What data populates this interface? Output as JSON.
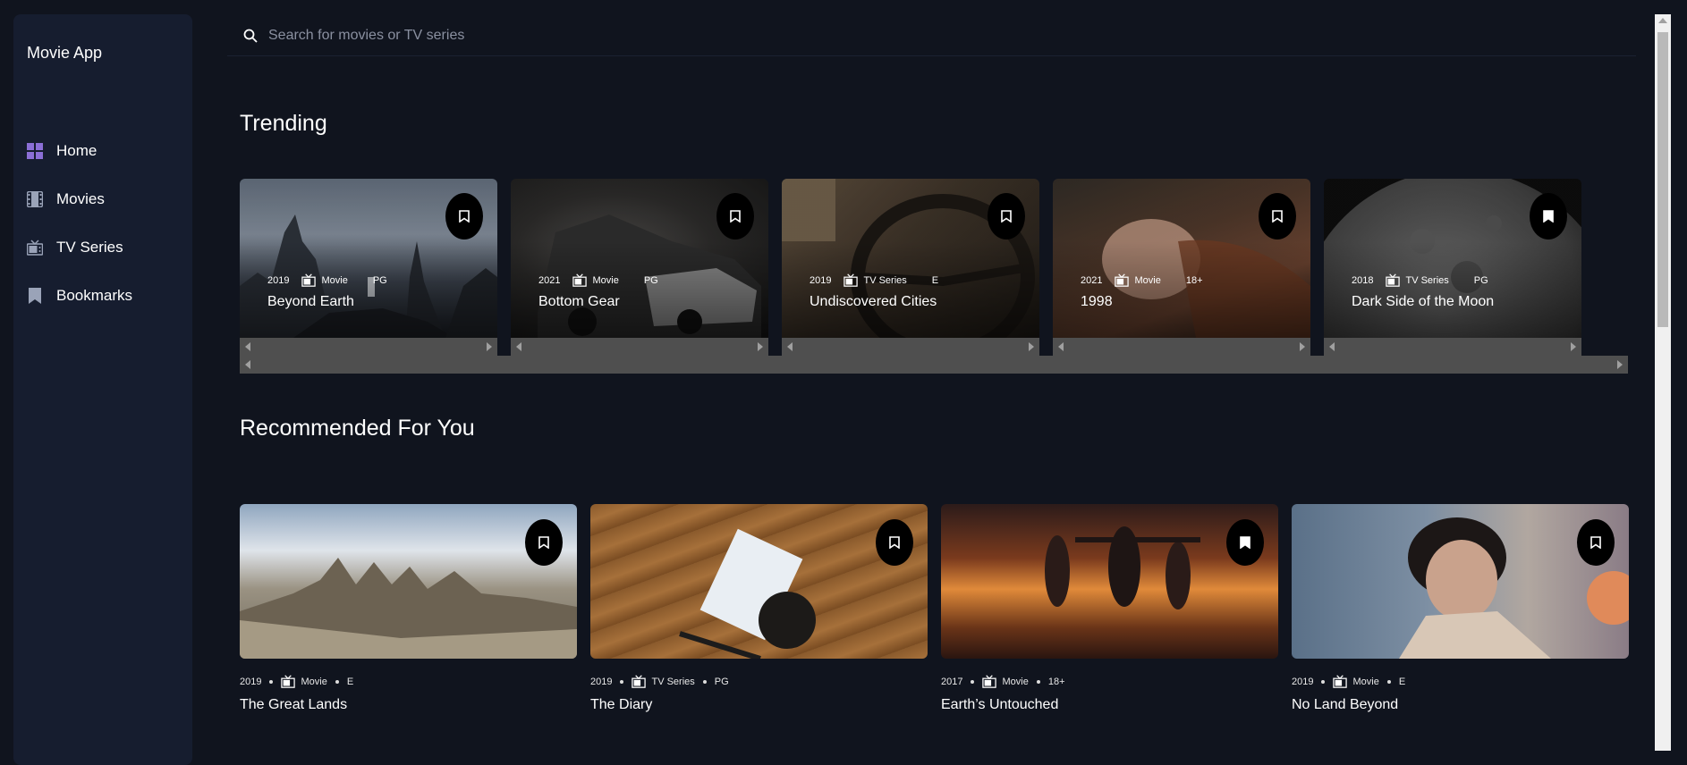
{
  "app": {
    "title": "Movie App"
  },
  "sidebar": {
    "items": [
      {
        "label": "Home",
        "icon": "grid-icon",
        "active": true
      },
      {
        "label": "Movies",
        "icon": "film-icon"
      },
      {
        "label": "TV Series",
        "icon": "tv-icon"
      },
      {
        "label": "Bookmarks",
        "icon": "bookmark-icon"
      }
    ]
  },
  "search": {
    "placeholder": "Search for movies or TV series"
  },
  "trending": {
    "title": "Trending",
    "items": [
      {
        "year": "2019",
        "category": "Movie",
        "rating": "PG",
        "title": "Beyond Earth",
        "bookmarked": false
      },
      {
        "year": "2021",
        "category": "Movie",
        "rating": "PG",
        "title": "Bottom Gear",
        "bookmarked": false
      },
      {
        "year": "2019",
        "category": "TV Series",
        "rating": "E",
        "title": "Undiscovered Cities",
        "bookmarked": false
      },
      {
        "year": "2021",
        "category": "Movie",
        "rating": "18+",
        "title": "1998",
        "bookmarked": false
      },
      {
        "year": "2018",
        "category": "TV Series",
        "rating": "PG",
        "title": "Dark Side of the Moon",
        "bookmarked": true
      }
    ]
  },
  "recommended": {
    "title": "Recommended For You",
    "items": [
      {
        "year": "2019",
        "category": "Movie",
        "rating": "E",
        "title": "The Great Lands",
        "bookmarked": false
      },
      {
        "year": "2019",
        "category": "TV Series",
        "rating": "PG",
        "title": "The Diary",
        "bookmarked": false
      },
      {
        "year": "2017",
        "category": "Movie",
        "rating": "18+",
        "title": "Earth’s Untouched",
        "bookmarked": true
      },
      {
        "year": "2019",
        "category": "Movie",
        "rating": "E",
        "title": "No Land Beyond",
        "bookmarked": false
      }
    ]
  },
  "colors": {
    "background": "#10141e",
    "sidebar": "#161d2f",
    "accent": "#8b6fd6"
  }
}
